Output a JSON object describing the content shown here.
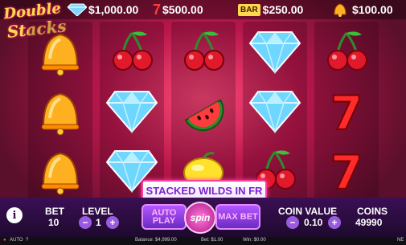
{
  "game": {
    "logo_line1": "Double",
    "logo_line2": "Stacks"
  },
  "jackpots": [
    {
      "icon": "diamond",
      "value": "$1,000.00"
    },
    {
      "icon": "seven",
      "value": "$500.00"
    },
    {
      "icon": "bar",
      "label": "BAR",
      "value": "$250.00"
    },
    {
      "icon": "bell",
      "value": "$100.00"
    }
  ],
  "reels": [
    [
      "bell",
      "bell",
      "bell"
    ],
    [
      "cherry",
      "diamond",
      "diamond"
    ],
    [
      "cherry",
      "watermelon",
      "lemon"
    ],
    [
      "diamond",
      "diamond",
      "cherry"
    ],
    [
      "cherry",
      "seven",
      "seven"
    ]
  ],
  "banner": {
    "text": "STACKED WILDS IN FR"
  },
  "controls": {
    "bet_label": "BET",
    "bet_value": "10",
    "level_label": "LEVEL",
    "level_value": "1",
    "auto_label": "AUTO PLAY",
    "spin_label": "spin",
    "max_label": "MAX BET",
    "coin_value_label": "COIN VALUE",
    "coin_value": "0.10",
    "coins_label": "COINS",
    "coins_value": "49990",
    "minus": "−",
    "plus": "+"
  },
  "status": {
    "auto": "AUTO",
    "help": "?",
    "balance": "Balance: $4,999.00",
    "bet": "Bet: $1.00",
    "win": "Win: $0.00",
    "brand": "NE"
  },
  "colors": {
    "accent": "#ff3fa0",
    "panel": "#3b0f55",
    "gold": "#ffd84d"
  }
}
